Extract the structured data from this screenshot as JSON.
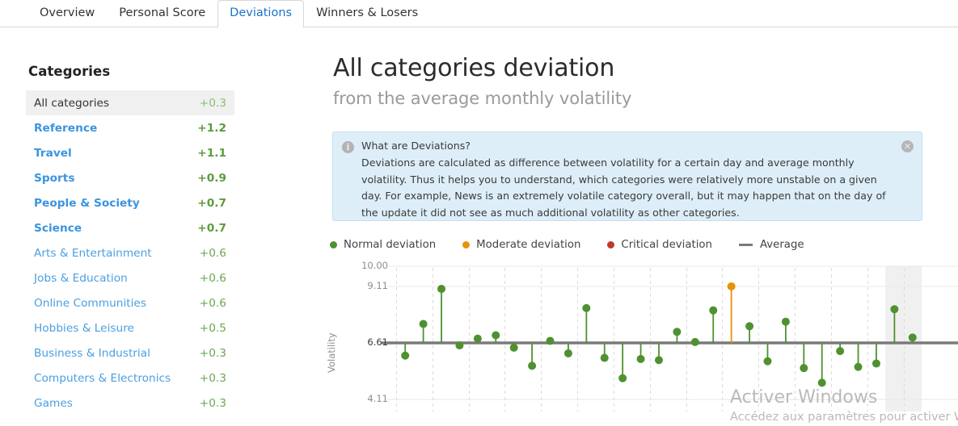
{
  "tabs": [
    {
      "label": "Overview",
      "active": false
    },
    {
      "label": "Personal Score",
      "active": false
    },
    {
      "label": "Deviations",
      "active": true
    },
    {
      "label": "Winners & Losers",
      "active": false
    }
  ],
  "sidebar": {
    "title": "Categories",
    "items": [
      {
        "label": "All categories",
        "value": "+0.3",
        "selected": true,
        "bold": false
      },
      {
        "label": "Reference",
        "value": "+1.2",
        "selected": false,
        "bold": true
      },
      {
        "label": "Travel",
        "value": "+1.1",
        "selected": false,
        "bold": true
      },
      {
        "label": "Sports",
        "value": "+0.9",
        "selected": false,
        "bold": true
      },
      {
        "label": "People & Society",
        "value": "+0.7",
        "selected": false,
        "bold": true
      },
      {
        "label": "Science",
        "value": "+0.7",
        "selected": false,
        "bold": true
      },
      {
        "label": "Arts & Entertainment",
        "value": "+0.6",
        "selected": false,
        "bold": false
      },
      {
        "label": "Jobs & Education",
        "value": "+0.6",
        "selected": false,
        "bold": false
      },
      {
        "label": "Online Communities",
        "value": "+0.6",
        "selected": false,
        "bold": false
      },
      {
        "label": "Hobbies & Leisure",
        "value": "+0.5",
        "selected": false,
        "bold": false
      },
      {
        "label": "Business & Industrial",
        "value": "+0.3",
        "selected": false,
        "bold": false
      },
      {
        "label": "Computers & Electronics",
        "value": "+0.3",
        "selected": false,
        "bold": false
      },
      {
        "label": "Games",
        "value": "+0.3",
        "selected": false,
        "bold": false
      }
    ]
  },
  "main": {
    "title": "All categories deviation",
    "subtitle": "from the average monthly volatility"
  },
  "infobox": {
    "icon": "info-icon",
    "close_icon": "close-icon",
    "heading": "What are Deviations?",
    "body": "Deviations are calculated as difference between volatility for a certain day and average monthly volatility. Thus it helps you to understand, which categories were relatively more unstable on a given day. For example, News is an extremely volatile category overall, but it may happen that on the day of the update it did not see as much additional volatility as other categories."
  },
  "watermark": {
    "line1": "Activer Windows",
    "line2": "Accédez aux paramètres pour activer Win"
  },
  "colors": {
    "normal": "#4f9130",
    "moderate": "#e8920c",
    "critical": "#c0392b",
    "average_line": "#7a7a7a",
    "accent_blue": "#1a73c7",
    "link_blue": "#4a9fe0",
    "value_green": "#6aa84f"
  },
  "chart_data": {
    "type": "scatter",
    "title": "All categories deviation",
    "subtitle": "from the average monthly volatility",
    "xlabel": "",
    "ylabel": "Volatility",
    "ylim": [
      3.6,
      10.0
    ],
    "yticks": [
      10.0,
      9.11,
      6.61,
      4.11
    ],
    "ytick_labels": [
      "10.00",
      "9.11",
      "6.61",
      "4.11"
    ],
    "grid": "vertical-dashed-and-horizontal",
    "legend_position": "above-plot",
    "average": 6.61,
    "legend": [
      {
        "label": "Normal deviation",
        "color": "#4f9130",
        "marker": "dot"
      },
      {
        "label": "Moderate deviation",
        "color": "#e8920c",
        "marker": "dot"
      },
      {
        "label": "Critical deviation",
        "color": "#c0392b",
        "marker": "dot"
      },
      {
        "label": "Average",
        "color": "#7a7a7a",
        "marker": "line"
      }
    ],
    "highlight_bands": [
      {
        "start_index": 27,
        "end_index": 28
      }
    ],
    "points": [
      {
        "i": 0,
        "value": 6.05,
        "status": "normal"
      },
      {
        "i": 1,
        "value": 7.45,
        "status": "normal"
      },
      {
        "i": 2,
        "value": 9.0,
        "status": "normal"
      },
      {
        "i": 3,
        "value": 6.5,
        "status": "normal"
      },
      {
        "i": 4,
        "value": 6.8,
        "status": "normal"
      },
      {
        "i": 5,
        "value": 6.95,
        "status": "normal"
      },
      {
        "i": 6,
        "value": 6.4,
        "status": "normal"
      },
      {
        "i": 7,
        "value": 5.6,
        "status": "normal"
      },
      {
        "i": 8,
        "value": 6.7,
        "status": "normal"
      },
      {
        "i": 9,
        "value": 6.15,
        "status": "normal"
      },
      {
        "i": 10,
        "value": 8.15,
        "status": "normal"
      },
      {
        "i": 11,
        "value": 5.95,
        "status": "normal"
      },
      {
        "i": 12,
        "value": 5.05,
        "status": "normal"
      },
      {
        "i": 13,
        "value": 5.9,
        "status": "normal"
      },
      {
        "i": 14,
        "value": 5.85,
        "status": "normal"
      },
      {
        "i": 15,
        "value": 7.1,
        "status": "normal"
      },
      {
        "i": 16,
        "value": 6.65,
        "status": "normal"
      },
      {
        "i": 17,
        "value": 8.05,
        "status": "normal"
      },
      {
        "i": 18,
        "value": 9.11,
        "status": "moderate"
      },
      {
        "i": 19,
        "value": 7.35,
        "status": "normal"
      },
      {
        "i": 20,
        "value": 5.8,
        "status": "normal"
      },
      {
        "i": 21,
        "value": 7.55,
        "status": "normal"
      },
      {
        "i": 22,
        "value": 5.5,
        "status": "normal"
      },
      {
        "i": 23,
        "value": 4.85,
        "status": "normal"
      },
      {
        "i": 24,
        "value": 6.25,
        "status": "normal"
      },
      {
        "i": 25,
        "value": 5.55,
        "status": "normal"
      },
      {
        "i": 26,
        "value": 5.7,
        "status": "normal"
      },
      {
        "i": 27,
        "value": 8.1,
        "status": "normal"
      },
      {
        "i": 28,
        "value": 6.85,
        "status": "normal"
      }
    ]
  }
}
